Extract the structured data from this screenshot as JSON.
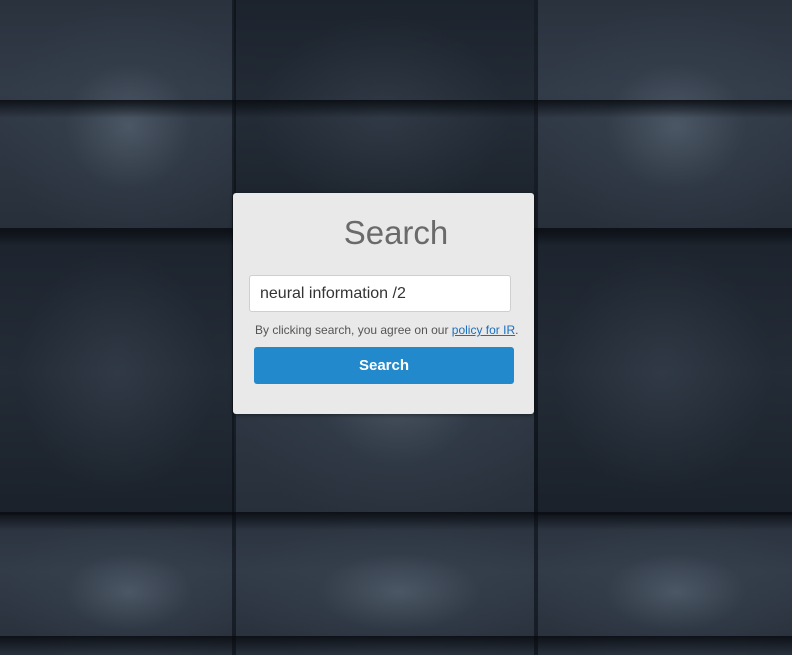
{
  "card": {
    "title": "Search"
  },
  "search": {
    "value": "neural information /2",
    "placeholder": ""
  },
  "agreement": {
    "prefix": "By clicking search, you agree on our ",
    "link": "policy for IR",
    "suffix": "."
  },
  "button": {
    "label": "Search",
    "color": "#2189cc"
  }
}
